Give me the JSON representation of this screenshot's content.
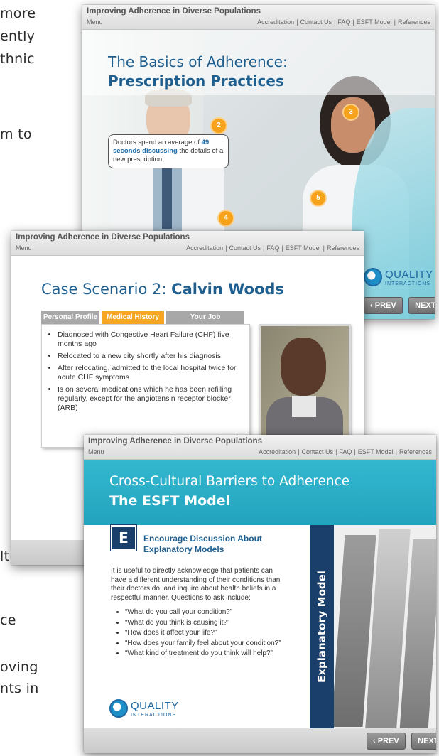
{
  "background_text": [
    "more",
    "ently",
    "thnic",
    "m  to",
    "ltural",
    "ce",
    "oving",
    "nts in"
  ],
  "slide1": {
    "header_title": "Improving Adherence in Diverse Populations",
    "menu": "Menu",
    "links": [
      "Accreditation",
      "Contact Us",
      "FAQ",
      "ESFT Model",
      "References"
    ],
    "heading_line1": "The Basics of Adherence:",
    "heading_line2": "Prescription Practices",
    "callout_prefix": "Doctors spend an average of",
    "callout_highlight": "49 seconds discussing",
    "callout_suffix": "the details of a new prescription.",
    "markers": [
      "2",
      "3",
      "4",
      "5"
    ],
    "logo_name": "QUALITY",
    "logo_sub": "INTERACTIONS",
    "prev": "PREV",
    "next": "NEXT"
  },
  "slide2": {
    "header_title": "Improving Adherence in Diverse Populations",
    "menu": "Menu",
    "links": [
      "Accreditation",
      "Contact Us",
      "FAQ",
      "ESFT Model",
      "References"
    ],
    "heading_light": "Case Scenario 2:",
    "heading_bold": "Calvin Woods",
    "tabs": [
      "Personal Profile",
      "Medical History",
      "Your Job"
    ],
    "active_tab": 1,
    "bullets": [
      "Diagnosed with Congestive Heart Failure (CHF) five months ago",
      "Relocated to a new city shortly after his diagnosis",
      "After relocating, admitted to the local hospital twice for acute CHF symptoms",
      "Is on several medications which he has been refilling regularly, except for the angiotensin receptor blocker (ARB)"
    ]
  },
  "slide3": {
    "header_title": "Improving Adherence in Diverse Populations",
    "menu": "Menu",
    "links": [
      "Accreditation",
      "Contact Us",
      "FAQ",
      "ESFT Model",
      "References"
    ],
    "heading_line1": "Cross-Cultural Barriers to Adherence",
    "heading_line2": "The ESFT Model",
    "letter": "E",
    "sub_heading": "Encourage Discussion About Explanatory Models",
    "body": "It is useful to directly acknowledge that patients can have a different understanding of their conditions than their doctors do, and inquire about health beliefs in a respectful manner. Questions to ask include:",
    "questions": [
      "“What do you call your condition?”",
      "“What do you think is causing it?”",
      "“How does it affect your life?”",
      "“How does your family feel about your condition?”",
      "“What kind of treatment do you think will help?”"
    ],
    "vertical_label": "Explanatory Model",
    "logo_name": "QUALITY",
    "logo_sub": "INTERACTIONS",
    "prev": "PREV",
    "next": "NEXT"
  },
  "colors": {
    "accent_blue": "#1f6aa5",
    "teal": "#2fb3cc",
    "orange": "#f7a21b",
    "navy": "#1a3f6b"
  }
}
